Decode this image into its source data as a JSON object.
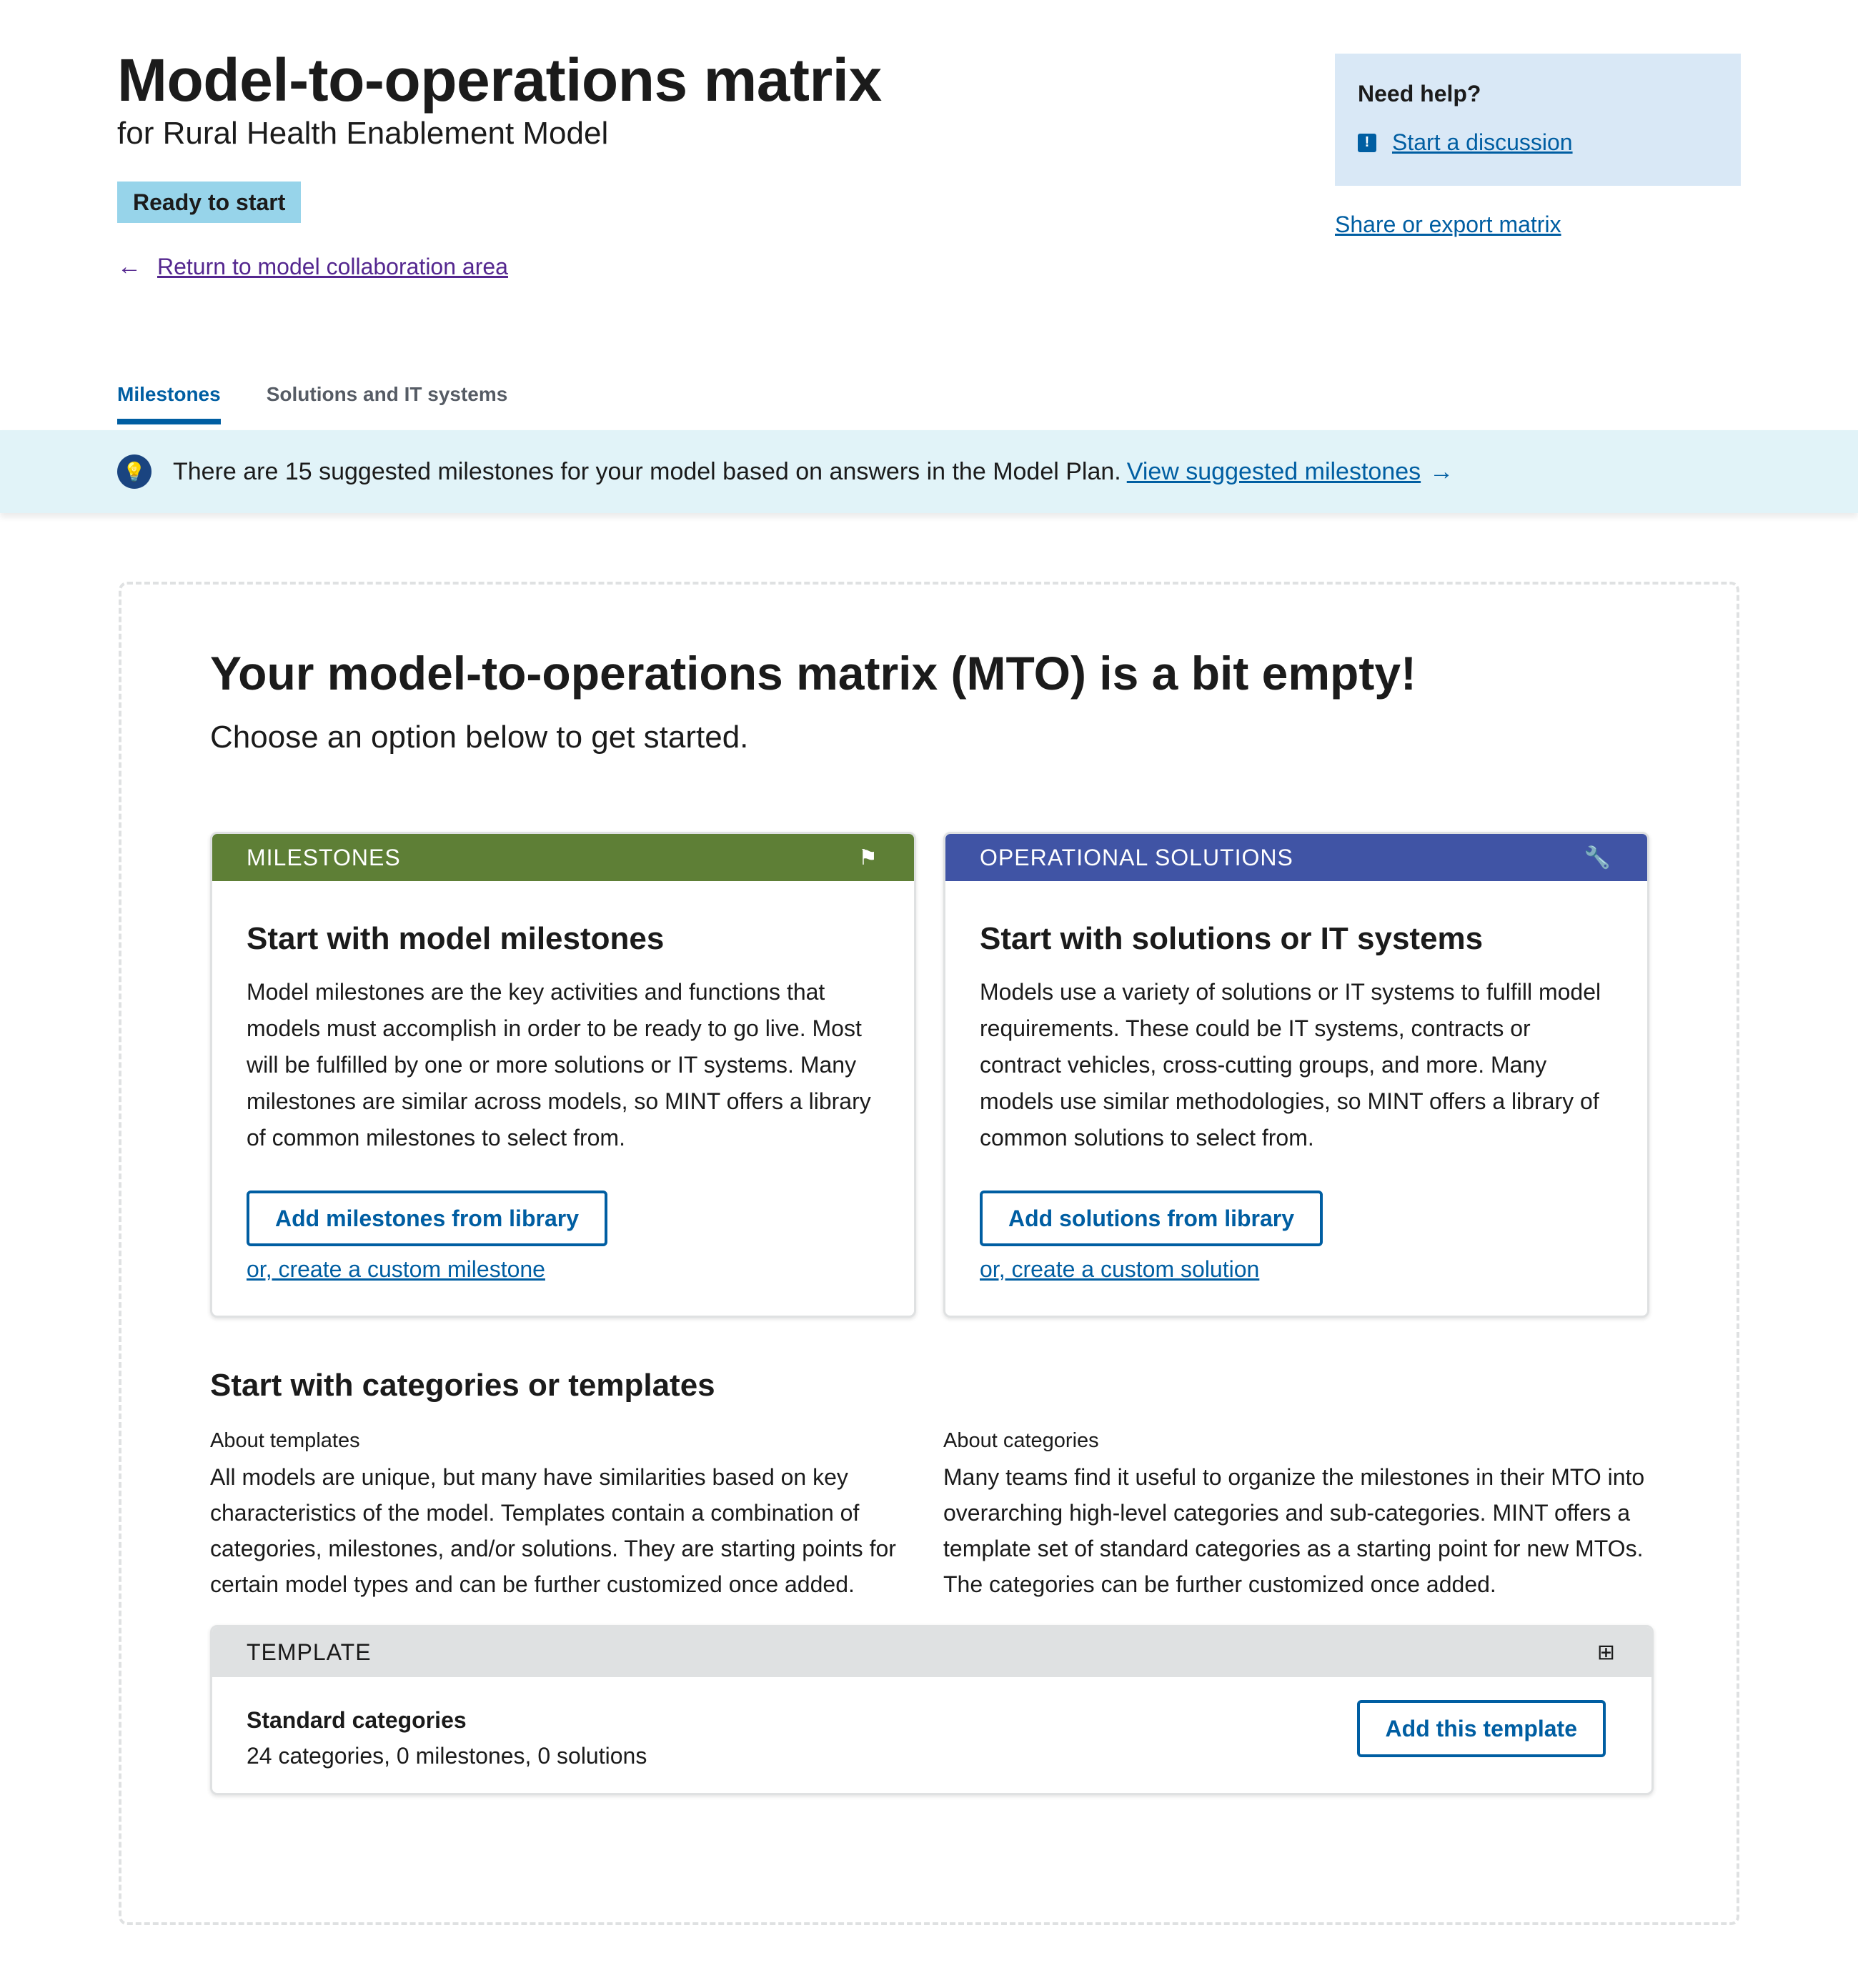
{
  "header": {
    "title": "Model-to-operations matrix",
    "subtitle": "for Rural Health Enablement Model",
    "status": "Ready to start",
    "back_link": "Return to model collaboration area"
  },
  "help": {
    "title": "Need help?",
    "discussion_link": "Start a discussion",
    "share_link": "Share or export matrix"
  },
  "tabs": [
    {
      "label": "Milestones",
      "active": true
    },
    {
      "label": "Solutions and IT systems",
      "active": false
    }
  ],
  "banner": {
    "text": "There are 15 suggested milestones for your model based on answers in the Model Plan.",
    "link": "View suggested milestones"
  },
  "empty_state": {
    "title": "Your model-to-operations matrix (MTO) is a bit empty!",
    "subtitle": "Choose an option below to get started."
  },
  "milestones_card": {
    "header": "MILESTONES",
    "title": "Start with model milestones",
    "text": "Model milestones are the key activities and functions that models must accomplish in order to be ready to go live. Most will be fulfilled by one or more solutions or IT systems. Many milestones are similar across models, so MINT offers a library of common milestones to select from.",
    "button": "Add milestones from library",
    "custom_link": "or, create a custom milestone",
    "header_color": "#5e7f36"
  },
  "solutions_card": {
    "header": "OPERATIONAL SOLUTIONS",
    "title": "Start with solutions or IT systems",
    "text": "Models use a variety of solutions or IT systems to fulfill model requirements. These could be IT systems, contracts or contract vehicles, cross-cutting groups, and more. Many models use similar methodologies, so MINT offers a library of common solutions to select from.",
    "button": "Add solutions from library",
    "custom_link": "or, create a custom solution",
    "header_color": "#4054a5"
  },
  "templates_section": {
    "title": "Start with categories or templates",
    "about_templates_label": "About templates",
    "about_templates_text": "All models are unique, but many have similarities based on key characteristics of the model. Templates contain a combination of categories, milestones, and/or solutions. They are starting points for certain model types and can be further customized once added.",
    "about_categories_label": "About categories",
    "about_categories_text": "Many teams find it useful to organize the milestones in their MTO into overarching high-level categories and sub-categories. MINT offers a template set of standard categories as a starting point for new MTOs. The categories can be further customized once added."
  },
  "template_card": {
    "header": "TEMPLATE",
    "name": "Standard categories",
    "description": "24 categories, 0 milestones, 0 solutions",
    "button": "Add this template"
  },
  "icons": {
    "back": "arrow-left-icon",
    "discussion": "announcement-icon",
    "banner": "lightbulb-icon",
    "milestones": "flag-icon",
    "solutions": "wrench-icon",
    "template": "grid-icon"
  }
}
